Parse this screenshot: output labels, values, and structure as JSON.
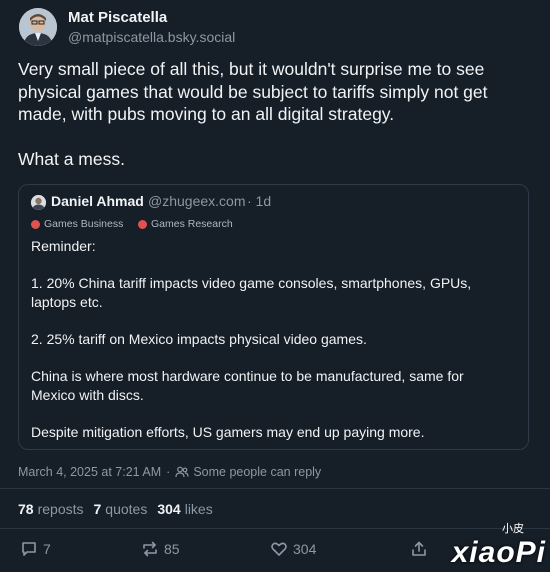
{
  "author": {
    "name": "Mat Piscatella",
    "handle": "@matpiscatella.bsky.social"
  },
  "post": {
    "text": "Very small piece of all this, but it wouldn't surprise me to see physical games that would be subject to tariffs simply not get made, with pubs moving to an all digital strategy.\n\nWhat a mess."
  },
  "quote": {
    "name": "Daniel Ahmad",
    "handle": "@zhugeex.com",
    "time": "· 1d",
    "tags": [
      "Games Business",
      "Games Research"
    ],
    "text": "Reminder:\n\n1. 20% China tariff impacts video game consoles, smartphones, GPUs, laptops etc.\n\n2. 25% tariff on Mexico impacts physical video games.\n\nChina is where most hardware continue to be manufactured, same for Mexico with discs.\n\nDespite mitigation efforts, US gamers may end up paying more."
  },
  "meta": {
    "timestamp": "March 4, 2025 at 7:21 AM",
    "separator": "·",
    "reply_setting": "Some people can reply"
  },
  "stats": {
    "reposts_count": "78",
    "reposts_label": "reposts",
    "quotes_count": "7",
    "quotes_label": "quotes",
    "likes_count": "304",
    "likes_label": "likes"
  },
  "actions": {
    "reply_count": "7",
    "repost_count": "85",
    "like_count": "304"
  },
  "watermark": {
    "main": "xiaoPi",
    "small": "小皮"
  },
  "colors": {
    "background": "#161e27",
    "text": "#f1f3f5",
    "muted": "#8b98a5",
    "border": "#2e3a47",
    "tag_dot": "#e0524f"
  }
}
